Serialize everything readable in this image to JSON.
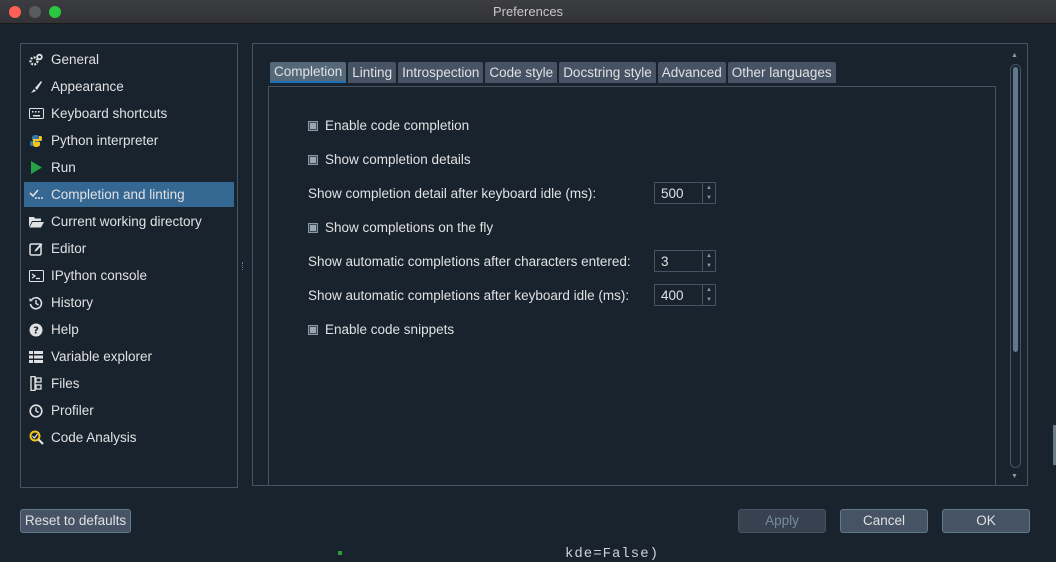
{
  "window": {
    "title": "Preferences"
  },
  "sidebar": {
    "items": [
      {
        "label": "General",
        "icon": "gears-icon"
      },
      {
        "label": "Appearance",
        "icon": "paintbrush-icon"
      },
      {
        "label": "Keyboard shortcuts",
        "icon": "keyboard-icon"
      },
      {
        "label": "Python interpreter",
        "icon": "python-icon"
      },
      {
        "label": "Run",
        "icon": "play-icon"
      },
      {
        "label": "Completion and linting",
        "icon": "completion-icon",
        "selected": true
      },
      {
        "label": "Current working directory",
        "icon": "folder-open-icon"
      },
      {
        "label": "Editor",
        "icon": "edit-icon"
      },
      {
        "label": "IPython console",
        "icon": "ipython-icon"
      },
      {
        "label": "History",
        "icon": "history-icon"
      },
      {
        "label": "Help",
        "icon": "help-icon"
      },
      {
        "label": "Variable explorer",
        "icon": "table-icon"
      },
      {
        "label": "Files",
        "icon": "files-icon"
      },
      {
        "label": "Profiler",
        "icon": "clock-icon"
      },
      {
        "label": "Code Analysis",
        "icon": "analysis-icon"
      }
    ]
  },
  "tabs": {
    "items": [
      "Completion",
      "Linting",
      "Introspection",
      "Code style",
      "Docstring style",
      "Advanced",
      "Other languages"
    ],
    "active": "Completion"
  },
  "options": {
    "enable_completion": {
      "label": "Enable code completion",
      "checked": true
    },
    "show_details": {
      "label": "Show completion details",
      "checked": true
    },
    "detail_idle": {
      "label": "Show completion detail after keyboard idle (ms):",
      "value": "500"
    },
    "on_the_fly": {
      "label": "Show completions on the fly",
      "checked": true
    },
    "after_chars": {
      "label": "Show automatic completions after characters entered:",
      "value": "3"
    },
    "after_idle": {
      "label": "Show automatic completions after keyboard idle (ms):",
      "value": "400"
    },
    "snippets": {
      "label": "Enable code snippets",
      "checked": true
    }
  },
  "buttons": {
    "reset": "Reset to defaults",
    "apply": "Apply",
    "cancel": "Cancel",
    "ok": "OK"
  },
  "background_text": "kde=False)",
  "colors": {
    "selected": "#346792",
    "background": "#19232d",
    "border": "#455364"
  }
}
